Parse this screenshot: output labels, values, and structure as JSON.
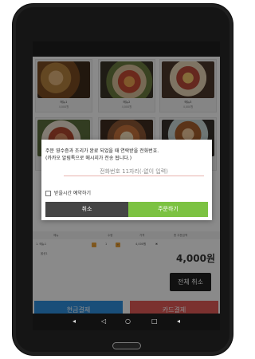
{
  "menu": {
    "items": [
      {
        "name": "메뉴1",
        "price": "4,000원"
      },
      {
        "name": "메뉴2",
        "price": "4,000원"
      },
      {
        "name": "메뉴3",
        "price": "4,000원"
      },
      {
        "name": "메뉴4",
        "price": "4,000원"
      },
      {
        "name": "메뉴5",
        "price": "4,000원"
      },
      {
        "name": "메뉴6",
        "price": "4,000원"
      }
    ]
  },
  "order_table": {
    "headers": [
      "메뉴",
      "수량",
      "가격",
      "총 주문금액"
    ],
    "row": {
      "name": "1. 메뉴1",
      "qty": "1",
      "price": "4,000원",
      "minus": "-",
      "plus": "+",
      "delete": "✖"
    },
    "option": "옵션1",
    "total": "4,000원"
  },
  "buttons": {
    "cancel_all": "전체 취소",
    "pay_cash": "현금결제",
    "pay_card": "카드결제"
  },
  "modal": {
    "line1": "주문 영수증과 조리가 완료 되었을 때 연락받을 전화번호.",
    "line2": "(카카오 알림톡으로 메시지가 전송 됩니다.)",
    "phone_placeholder": "전화번호 11자리(-없이 입력)",
    "checkbox_label": "받을시간 예약하기",
    "cancel": "취소",
    "order": "주문하기"
  },
  "navbar": {
    "icons": [
      "volume-down-icon",
      "back-icon",
      "home-icon",
      "recents-icon",
      "volume-up-icon"
    ]
  }
}
